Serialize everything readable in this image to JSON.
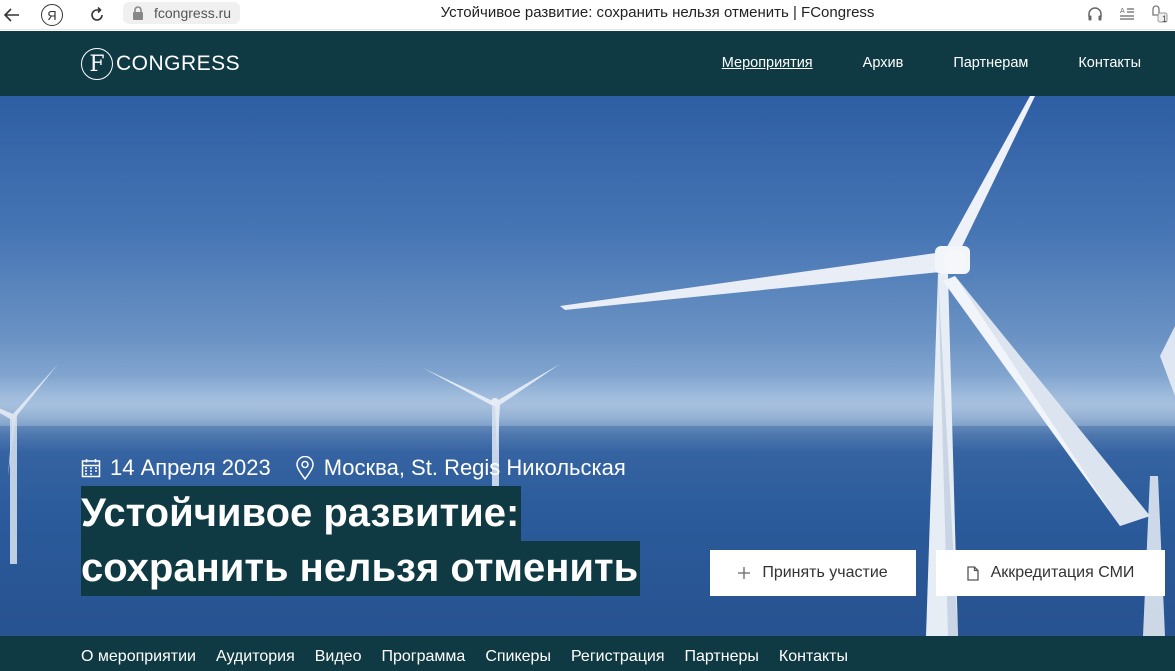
{
  "browser": {
    "url": "fcongress.ru",
    "tab_title": "Устойчивое развитие: сохранить нельзя отменить | FCongress",
    "ya_label": "Я",
    "notification_count": "1"
  },
  "header": {
    "logo_letter": "F",
    "logo_text": "CONGRESS",
    "nav": [
      {
        "label": "Мероприятия",
        "active": true
      },
      {
        "label": "Архив"
      },
      {
        "label": "Партнерам"
      },
      {
        "label": "Контакты"
      }
    ]
  },
  "hero": {
    "date": "14 Апреля 2023",
    "location": "Москва, St. Regis Никольская",
    "title_line1": "Устойчивое развитие:",
    "title_line2": "сохранить нельзя отменить",
    "join_label": "Принять участие",
    "press_label": "Аккредитация СМИ"
  },
  "sub_nav": [
    "О мероприятии",
    "Аудитория",
    "Видео",
    "Программа",
    "Спикеры",
    "Регистрация",
    "Партнеры",
    "Контакты"
  ],
  "colors": {
    "brand_dark": "#0f3a44",
    "sky": "#4675b4",
    "button_bg": "#ffffff"
  }
}
